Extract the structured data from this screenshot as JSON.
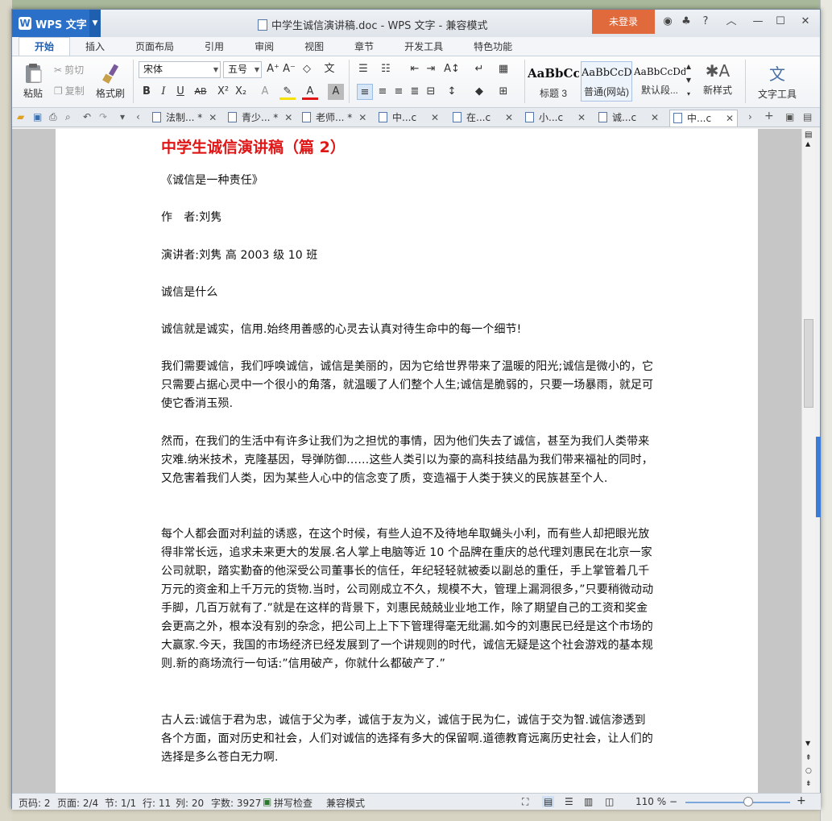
{
  "app": {
    "menu_label": "WPS 文字",
    "window_title": "中学生诚信演讲稿.doc - WPS 文字 - 兼容模式",
    "login": "未登录"
  },
  "ribbon_tabs": [
    "开始",
    "插入",
    "页面布局",
    "引用",
    "审阅",
    "视图",
    "章节",
    "开发工具",
    "特色功能"
  ],
  "ribbon": {
    "paste": "粘贴",
    "cut": "剪切",
    "copy": "复制",
    "format_painter": "格式刷",
    "font_name": "宋体",
    "font_size": "五号",
    "styles": [
      {
        "preview": "AaBbCcI",
        "name": "标题 3"
      },
      {
        "preview": "AaBbCcD",
        "name": "普通(网站)"
      },
      {
        "preview": "AaBbCcDd",
        "name": "默认段..."
      }
    ],
    "new_style": "新样式",
    "text_tools": "文字工具"
  },
  "doc_tabs": [
    {
      "label": "法制... *"
    },
    {
      "label": "青少... *"
    },
    {
      "label": "老师... *"
    },
    {
      "label": "中...c"
    },
    {
      "label": "在...c"
    },
    {
      "label": "小...c"
    },
    {
      "label": "诚...c"
    },
    {
      "label": "中...c"
    }
  ],
  "document": {
    "heading": "中学生诚信演讲稿（篇 2）",
    "paragraphs": [
      "《诚信是一种责任》",
      "作　者:刘隽",
      "演讲者:刘隽  高 2003 级 10 班",
      "诚信是什么",
      "诚信就是诚实，信用.始终用善感的心灵去认真对待生命中的每一个细节!",
      "我们需要诚信，我们呼唤诚信，诚信是美丽的，因为它给世界带来了温暖的阳光;诚信是微小的，它只需要占据心灵中一个很小的角落，就温暖了人们整个人生;诚信是脆弱的，只要一场暴雨，就足可使它香消玉殒.",
      "然而，在我们的生活中有许多让我们为之担忧的事情，因为他们失去了诚信，甚至为我们人类带来灾难.纳米技术，克隆基因，导弹防御……这些人类引以为豪的高科技结晶为我们带来福祉的同时，又危害着我们人类，因为某些人心中的信念变了质，变造福于人类于狭义的民族甚至个人.",
      "每个人都会面对利益的诱惑，在这个时候，有些人迫不及待地牟取蝇头小利，而有些人却把眼光放得非常长远，追求未来更大的发展.名人掌上电脑等近 10 个品牌在重庆的总代理刘惠民在北京一家公司就职，踏实勤奋的他深受公司董事长的信任，年纪轻轻就被委以副总的重任，手上掌管着几千万元的资金和上千万元的货物.当时，公司刚成立不久，规模不大，管理上漏洞很多，”只要稍微动动手脚，几百万就有了.”就是在这样的背景下，刘惠民兢兢业业地工作，除了期望自己的工资和奖金会更高之外，根本没有别的杂念，把公司上上下下管理得毫无纰漏.如今的刘惠民已经是这个市场的大赢家.今天，我国的市场经济已经发展到了一个讲规则的时代，诚信无疑是这个社会游戏的基本规则.新的商场流行一句话:”信用破产，你就什么都破产了.”",
      "古人云:诚信于君为忠，诚信于父为孝，诚信于友为义，诚信于民为仁，诚信于交为智.诚信渗透到各个方面，面对历史和社会，人们对诚信的选择有多大的保留啊.道德教育远离历史社会，让人们的选择是多么苍白无力啊."
    ]
  },
  "status": {
    "page_code": "页码: 2",
    "pages": "页面: 2/4",
    "section": "节: 1/1",
    "row": "行: 11",
    "col": "列: 20",
    "words": "字数: 3927",
    "spell": "拼写检查",
    "compat": "兼容模式",
    "zoom": "110 %",
    "zoom_level": 0.6
  }
}
